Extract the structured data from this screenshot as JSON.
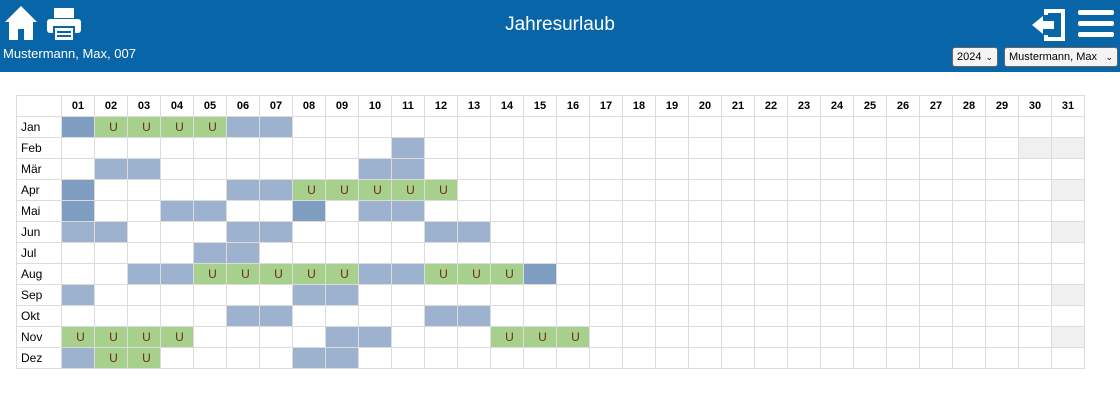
{
  "header": {
    "title": "Jahresurlaub",
    "user_label": "Mustermann, Max, 007",
    "year_select": {
      "value": "2024"
    },
    "employee_select": {
      "value": "Mustermann, Max"
    },
    "icons": [
      "home-icon",
      "printer-icon",
      "logout-icon",
      "menu-icon"
    ]
  },
  "colors": {
    "header_bg": "#0866a8",
    "weekend": "#9db2cf",
    "holiday": "#7f9cc1",
    "vacation": "#a8d08d",
    "vacation_text": "#6b2f12",
    "invalid_day": "#f0f0f0"
  },
  "calendar": {
    "day_headers": [
      "01",
      "02",
      "03",
      "04",
      "05",
      "06",
      "07",
      "08",
      "09",
      "10",
      "11",
      "12",
      "13",
      "14",
      "15",
      "16",
      "17",
      "18",
      "19",
      "20",
      "21",
      "22",
      "23",
      "24",
      "25",
      "26",
      "27",
      "28",
      "29",
      "30",
      "31"
    ],
    "vacation_mark": "U",
    "legend_codes": {
      "e": "empty",
      "w": "weekend",
      "h": "holiday",
      "u": "vacation",
      "x": "not-a-day"
    },
    "months": [
      {
        "name": "Jan",
        "days": "huuuuww"
      },
      {
        "name": "Feb",
        "days": "..........w"
      },
      {
        "name": "Mär",
        "days": ".ww......ww"
      },
      {
        "name": "Apr",
        "days": "h....wwuuuuu"
      },
      {
        "name": "Mai",
        "days": "h..ww..h.ww"
      },
      {
        "name": "Jun",
        "days": "ww...ww....ww"
      },
      {
        "name": "Jul",
        "days": "....ww"
      },
      {
        "name": "Aug",
        "days": "..wwuuuuuwwuuuh"
      },
      {
        "name": "Sep",
        "days": "w......ww"
      },
      {
        "name": "Okt",
        "days": ".....ww....ww"
      },
      {
        "name": "Nov",
        "days": "uuuu....ww...uuu"
      },
      {
        "name": "Dez",
        "days": "wuu....ww"
      }
    ]
  }
}
